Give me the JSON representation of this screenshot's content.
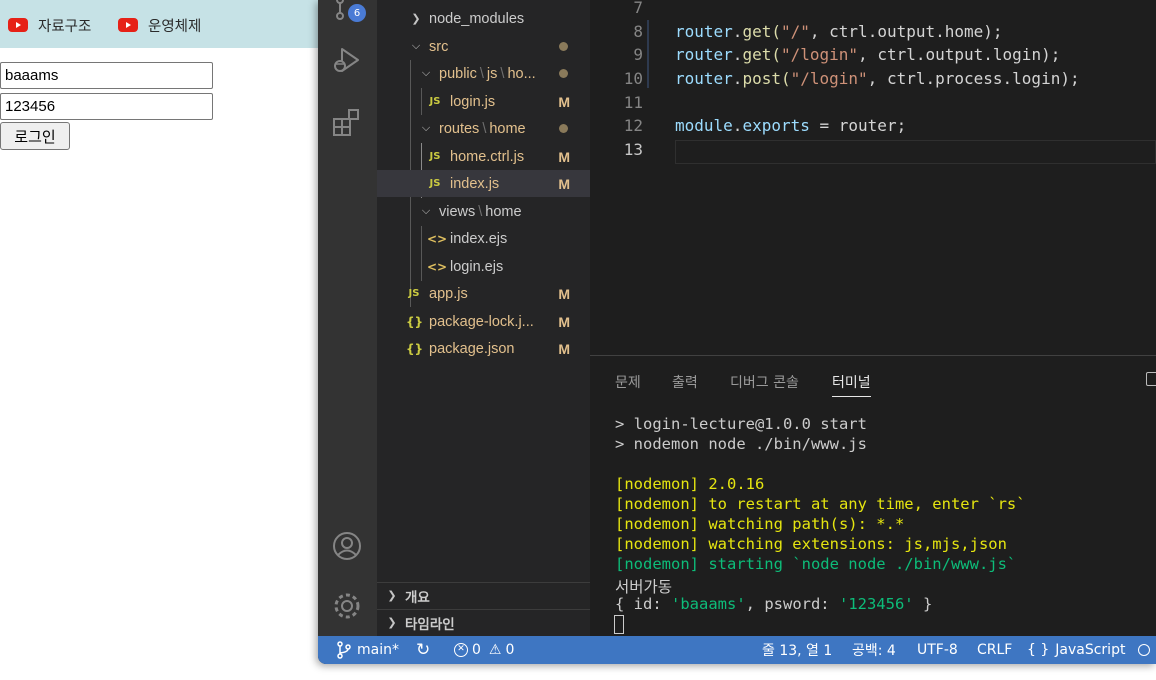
{
  "browser": {
    "bookmarks": [
      {
        "label": "자료구조",
        "icon": "youtube-icon"
      },
      {
        "label": "운영체제",
        "icon": "youtube-icon"
      }
    ],
    "id_value": "baaams",
    "pw_value": "123456",
    "login_label": "로그인"
  },
  "activity": {
    "scm_badge": "6"
  },
  "explorer": {
    "rows": [
      {
        "name": "node_modules",
        "type": "folder",
        "state": "collapsed",
        "status": ""
      },
      {
        "name": "src",
        "type": "folder",
        "state": "expanded",
        "status": "dot"
      },
      {
        "name_a": "public",
        "name_b": "js",
        "name_c": "ho...",
        "type": "folder",
        "state": "expanded",
        "status": "dot"
      },
      {
        "name": "login.js",
        "type": "js",
        "status": "M"
      },
      {
        "name_a": "routes",
        "name_b": "home",
        "type": "folder",
        "state": "expanded",
        "status": "dot"
      },
      {
        "name": "home.ctrl.js",
        "type": "js",
        "status": "M"
      },
      {
        "name": "index.js",
        "type": "js",
        "status": "M"
      },
      {
        "name_a": "views",
        "name_b": "home",
        "type": "folder",
        "state": "expanded",
        "status": ""
      },
      {
        "name": "index.ejs",
        "type": "ejs",
        "status": ""
      },
      {
        "name": "login.ejs",
        "type": "ejs",
        "status": ""
      },
      {
        "name": "app.js",
        "type": "js",
        "status": "M"
      },
      {
        "name": "package-lock.j...",
        "type": "json",
        "status": "M"
      },
      {
        "name": "package.json",
        "type": "json",
        "status": "M"
      }
    ],
    "file_badge_js": "JS",
    "file_badge_json": "{}",
    "file_badge_ejs": "<>",
    "sections": [
      "개요",
      "타임라인"
    ]
  },
  "editor": {
    "line_numbers": [
      "7",
      "8",
      "9",
      "10",
      "11",
      "12",
      "13"
    ],
    "lines": {
      "l8": {
        "obj": "router",
        "fn": "get",
        "str": "\"/\"",
        "rest": ", ctrl.output.home);"
      },
      "l9": {
        "obj": "router",
        "fn": "get",
        "str": "\"/login\"",
        "rest": ", ctrl.output.login);"
      },
      "l10": {
        "obj": "router",
        "fn": "post",
        "str": "\"/login\"",
        "rest": ", ctrl.process.login);"
      },
      "l12": {
        "obj": "module",
        "prop": "exports",
        "rest": " = router;"
      }
    }
  },
  "panel": {
    "tabs": [
      "문제",
      "출력",
      "디버그 콘솔",
      "터미널"
    ],
    "active_tab": "터미널",
    "terminal": {
      "t1": "> login-lecture@1.0.0 start",
      "t2": "> nodemon node ./bin/www.js",
      "t3": "[nodemon] 2.0.16",
      "t4": "[nodemon] to restart at any time, enter `rs`",
      "t5": "[nodemon] watching path(s): *.*",
      "t6": "[nodemon] watching extensions: js,mjs,json",
      "t7": "[nodemon] starting `node node ./bin/www.js`",
      "t8": "서버가동",
      "t9_a": "{ id: ",
      "t9_b": "'baaams'",
      "t9_c": ", psword: ",
      "t9_d": "'123456'",
      "t9_e": " }"
    }
  },
  "statusbar": {
    "branch": "main*",
    "errors": "0",
    "warnings": "0",
    "position": "줄 13, 열 1",
    "spaces": "공백: 4",
    "encoding": "UTF-8",
    "eol": "CRLF",
    "language_mode": "{ }",
    "language": "JavaScript"
  }
}
